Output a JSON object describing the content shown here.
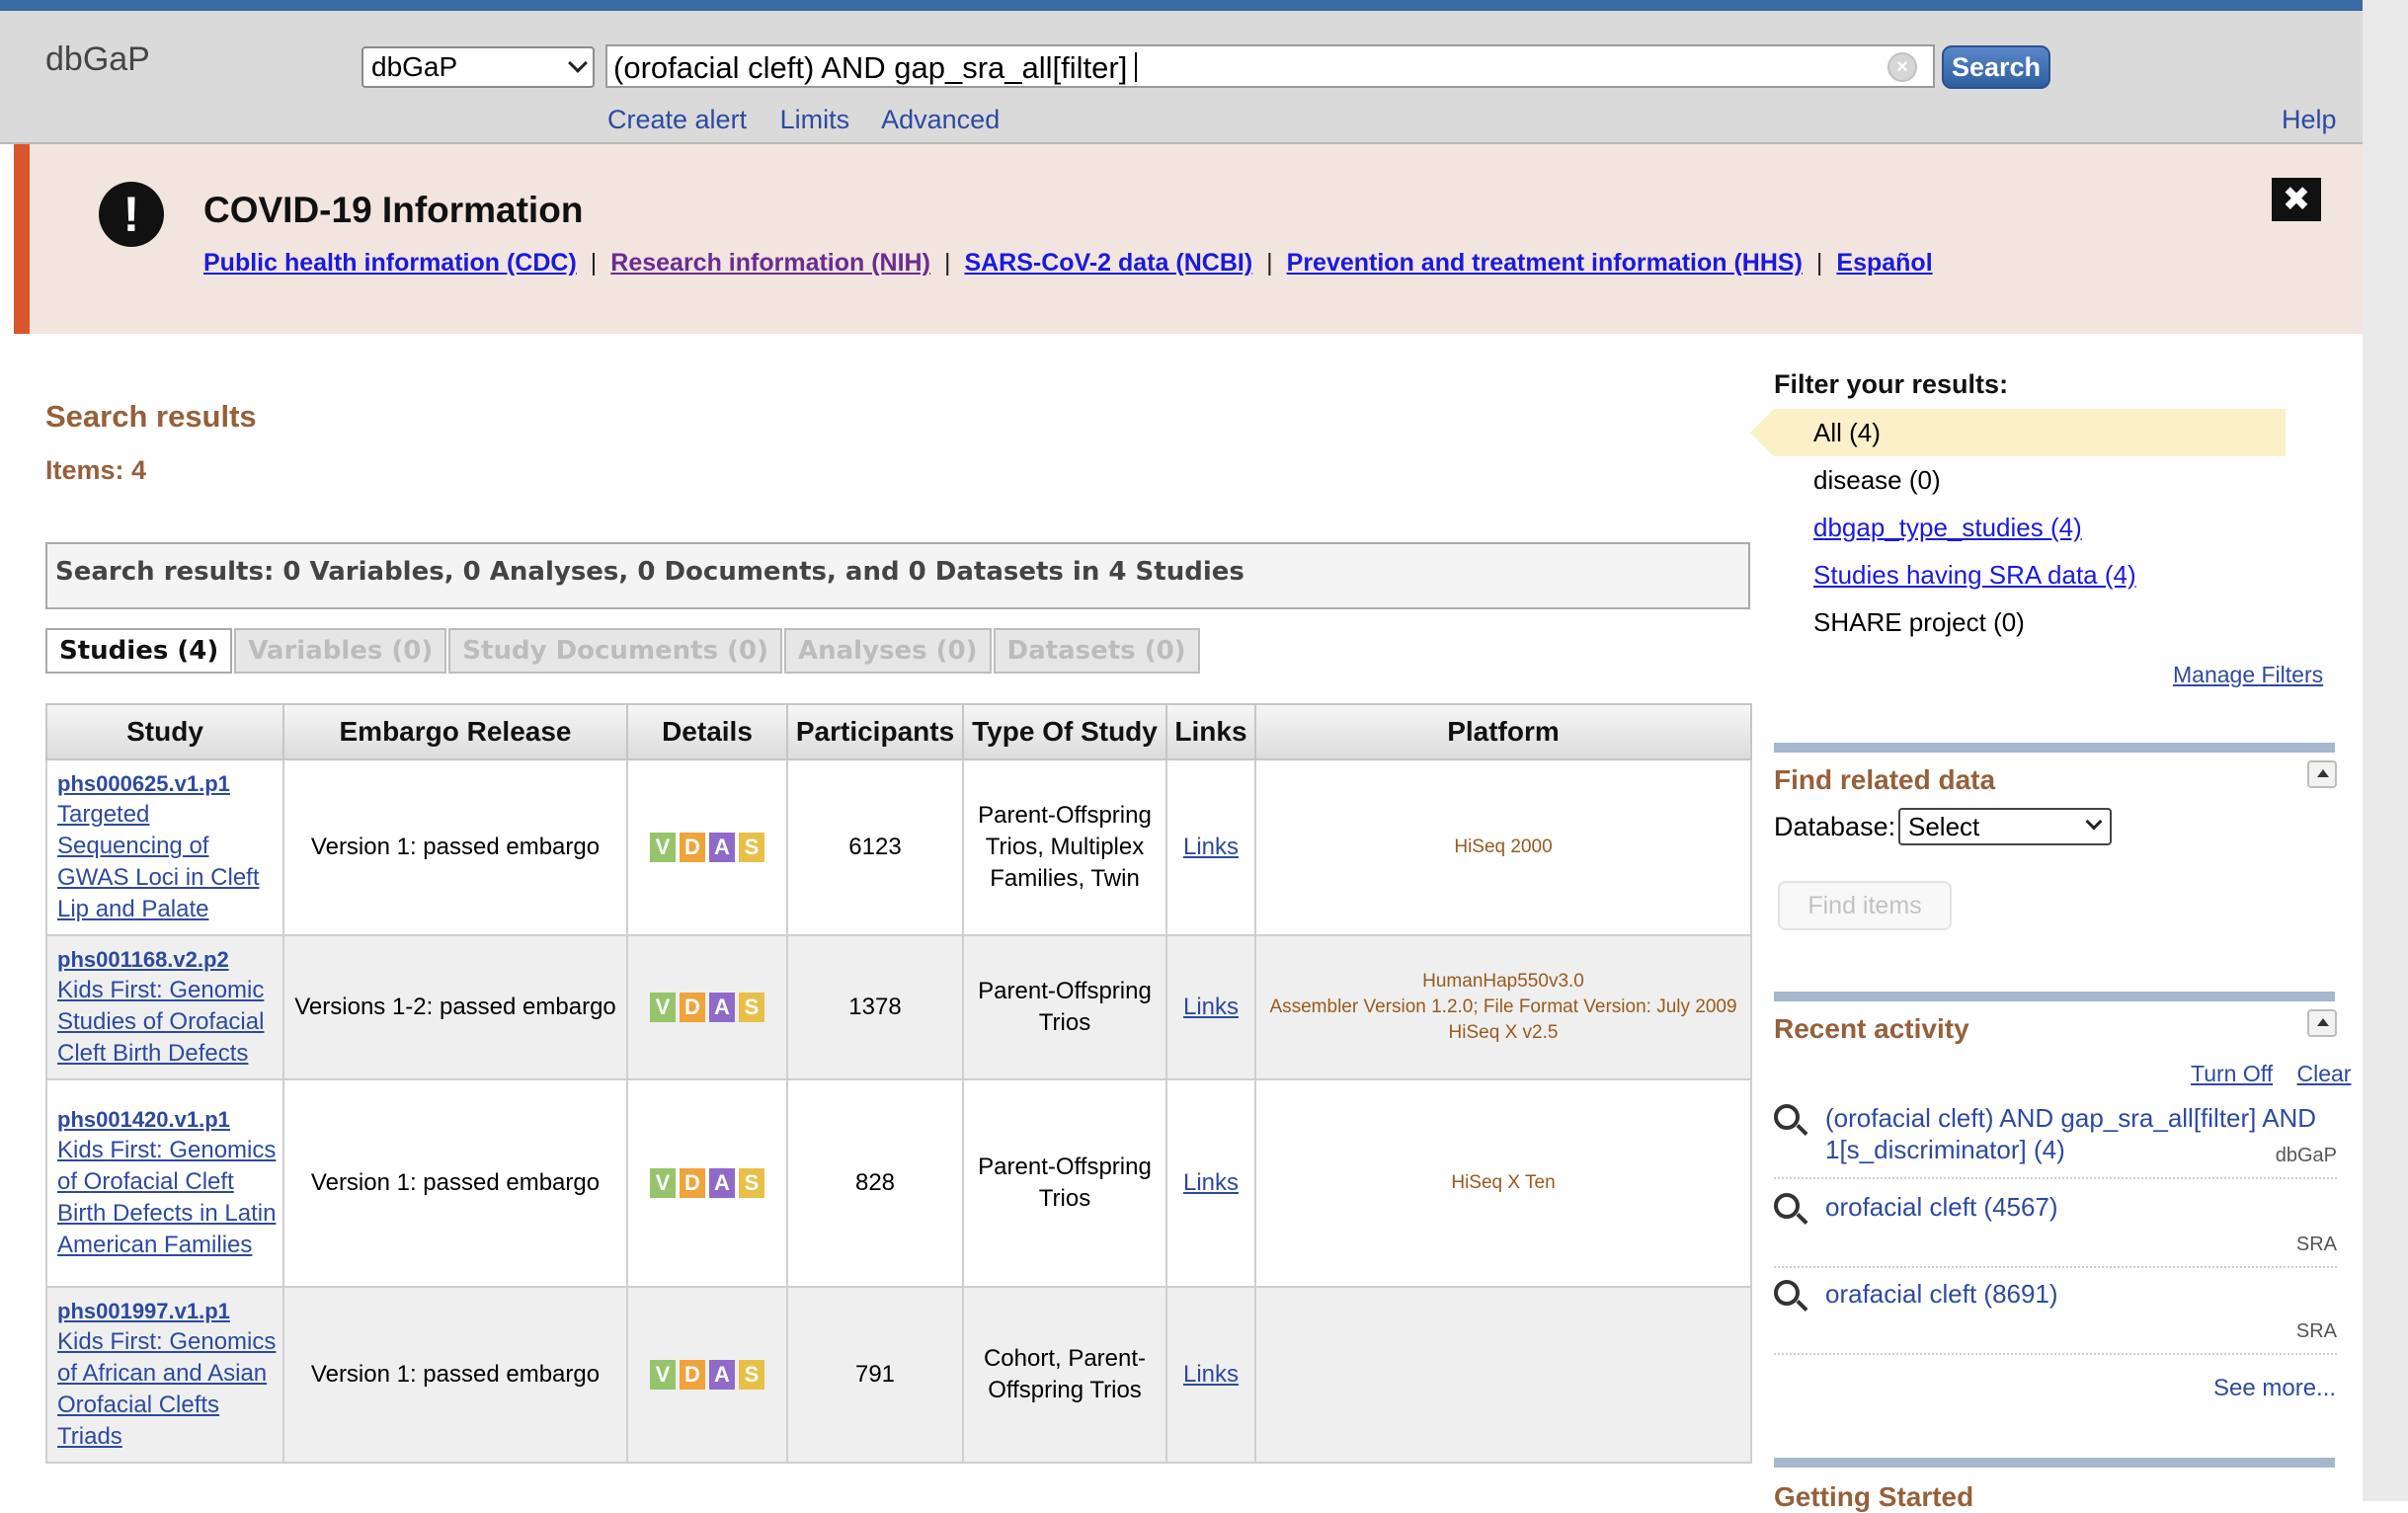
{
  "header": {
    "logo": "dbGaP",
    "db_select": "dbGaP",
    "query": "(orofacial cleft) AND gap_sra_all[filter]",
    "search_label": "Search",
    "sublinks": [
      "Create alert",
      "Limits",
      "Advanced"
    ],
    "help": "Help"
  },
  "covid": {
    "icon": "!",
    "title": "COVID-19 Information",
    "links": [
      {
        "label": "Public health information (CDC)"
      },
      {
        "label": "Research information (NIH)"
      },
      {
        "label": "SARS-CoV-2 data (NCBI)"
      },
      {
        "label": "Prevention and treatment information (HHS)"
      },
      {
        "label": "Español"
      }
    ],
    "separator": "|",
    "close": "✖"
  },
  "results": {
    "title": "Search results",
    "items": "Items: 4",
    "summary": "Search results: 0 Variables, 0 Analyses, 0 Documents, and 0 Datasets in 4 Studies",
    "tabs": [
      "Studies (4)",
      "Variables (0)",
      "Study Documents (0)",
      "Analyses (0)",
      "Datasets (0)"
    ],
    "columns": [
      "Study",
      "Embargo Release",
      "Details",
      "Participants",
      "Type Of Study",
      "Links",
      "Platform"
    ],
    "badges": [
      "V",
      "D",
      "A",
      "S"
    ],
    "rows": [
      {
        "accession": "phs000625.v1.p1",
        "title": "Targeted Sequencing of GWAS Loci in Cleft Lip and Palate",
        "embargo": "Version 1: passed embargo",
        "participants": "6123",
        "type": "Parent-Offspring Trios, Multiplex Families, Twin",
        "links": "Links",
        "platform": [
          "HiSeq 2000"
        ]
      },
      {
        "accession": "phs001168.v2.p2",
        "title": "Kids First: Genomic Studies of Orofacial Cleft Birth Defects",
        "embargo": "Versions 1-2: passed embargo",
        "participants": "1378",
        "type": "Parent-Offspring Trios",
        "links": "Links",
        "platform": [
          "HumanHap550v3.0",
          "Assembler Version 1.2.0; File Format Version: July 2009",
          "HiSeq X v2.5"
        ]
      },
      {
        "accession": "phs001420.v1.p1",
        "title": "Kids First: Genomics of Orofacial Cleft Birth Defects in Latin American Families",
        "embargo": "Version 1: passed embargo",
        "participants": "828",
        "type": "Parent-Offspring Trios",
        "links": "Links",
        "platform": [
          "HiSeq X Ten"
        ]
      },
      {
        "accession": "phs001997.v1.p1",
        "title": "Kids First: Genomics of African and Asian Orofacial Clefts Triads",
        "embargo": "Version 1: passed embargo",
        "participants": "791",
        "type": "Cohort, Parent-Offspring Trios",
        "links": "Links",
        "platform": []
      }
    ]
  },
  "filters": {
    "title": "Filter your results:",
    "items": [
      {
        "label": "All (4)",
        "selected": true,
        "link": false
      },
      {
        "label": "disease (0)",
        "selected": false,
        "link": false
      },
      {
        "label": "dbgap_type_studies (4)",
        "selected": false,
        "link": true
      },
      {
        "label": "Studies having SRA data (4)",
        "selected": false,
        "link": true
      },
      {
        "label": "SHARE project (0)",
        "selected": false,
        "link": false
      }
    ],
    "manage": "Manage Filters"
  },
  "related": {
    "title": "Find related data",
    "database_label": "Database:",
    "database_value": "Select",
    "find_button": "Find items"
  },
  "recent": {
    "title": "Recent activity",
    "turn_off": "Turn Off",
    "clear": "Clear",
    "items": [
      {
        "text": "(orofacial cleft) AND gap_sra_all[filter] AND 1[s_discriminator] (4)",
        "db": "dbGaP"
      },
      {
        "text": "orofacial cleft (4567)",
        "db": "SRA"
      },
      {
        "text": "orafacial cleft (8691)",
        "db": "SRA"
      }
    ],
    "see_more": "See more..."
  },
  "getting_started": "Getting Started",
  "colors": {
    "header_bg": "#dadada",
    "top_strip": "#3a6aa4",
    "covid_bg": "#f2e4df",
    "covid_accent": "#d9552c",
    "section_title": "#96603a",
    "link": "#2d4aa0"
  },
  "icons": {
    "search_clear": "clear-circle-icon",
    "covid": "exclamation-icon",
    "close": "close-icon",
    "recent": "magnifier-icon",
    "toggle": "collapse-arrow-icon"
  }
}
